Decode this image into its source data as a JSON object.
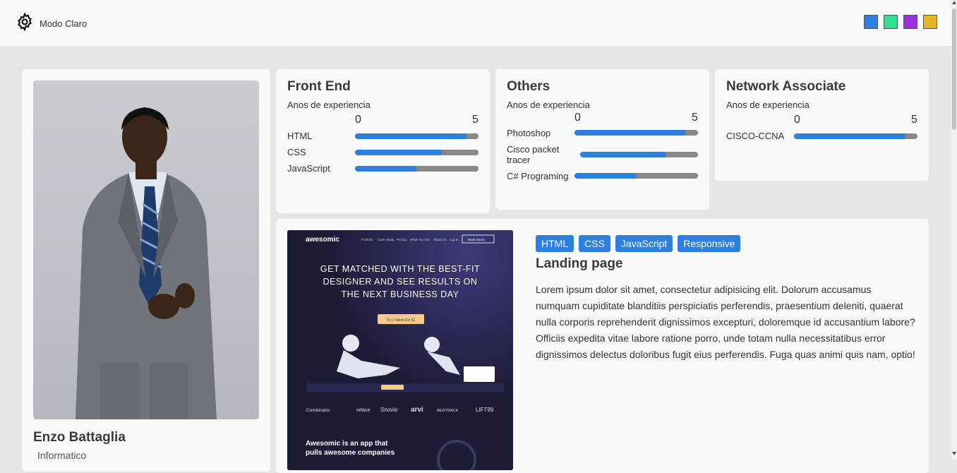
{
  "header": {
    "mode_label": "Modo Claro",
    "color_swatches": [
      "#2f7fe0",
      "#2ee08f",
      "#a02fe0",
      "#e6b422"
    ]
  },
  "profile": {
    "name": "Enzo Battaglia",
    "role": "Informatico"
  },
  "skill_cards": [
    {
      "title": "Front End",
      "subtitle": "Anos de experiencia",
      "scale_min": "0",
      "scale_max": "5",
      "skills": [
        {
          "name": "HTML",
          "level": 0.9
        },
        {
          "name": "CSS",
          "level": 0.7
        },
        {
          "name": "JavaScript",
          "level": 0.5
        }
      ]
    },
    {
      "title": "Others",
      "subtitle": "Anos de experiencia",
      "scale_min": "0",
      "scale_max": "5",
      "skills": [
        {
          "name": "Photoshop",
          "level": 0.9
        },
        {
          "name": "Cisco packet tracer",
          "level": 0.73
        },
        {
          "name": "C# Programing",
          "level": 0.5
        }
      ]
    },
    {
      "title": "Network Associate",
      "subtitle": "Anos de experiencia",
      "scale_min": "0",
      "scale_max": "5",
      "skills": [
        {
          "name": "CISCO-CCNA",
          "level": 0.9
        }
      ]
    }
  ],
  "project": {
    "tags": [
      "HTML",
      "CSS",
      "JavaScript",
      "Responsive"
    ],
    "title": "Landing page",
    "description": "Lorem ipsum dolor sit amet, consectetur adipisicing elit. Dolorum accusamus numquam cupiditate blanditiis perspiciatis perferendis, praesentium deleniti, quaerat nulla corporis reprehenderit dignissimos excepturi, doloremque id accusantium labore? Officiis expedita vitae labore ratione porro, unde totam nulla necessitatibus error dignissimos delectus doloribus fugit eius perferendis. Fuga quas animi quis nam, optio!",
    "screenshot": {
      "brand": "awesomic",
      "nav": [
        "Portfolio",
        "Case Study",
        "Pricing",
        "What You Get",
        "About Us",
        "Log In"
      ],
      "nav_button": "Book Demo",
      "headline_1": "GET MATCHED WITH THE BEST-FIT",
      "headline_2": "DESIGNER AND SEE RESULTS ON",
      "headline_3": "THE NEXT BUSINESS DAY",
      "cta": "Try 1 Week For $1",
      "logos": [
        "Combinator",
        "reface",
        "Snovio",
        "arvi",
        "REDTRACK",
        "LIFT99"
      ],
      "footer_1": "Awesomic is an app that",
      "footer_2": "pulls awesome companies"
    }
  }
}
